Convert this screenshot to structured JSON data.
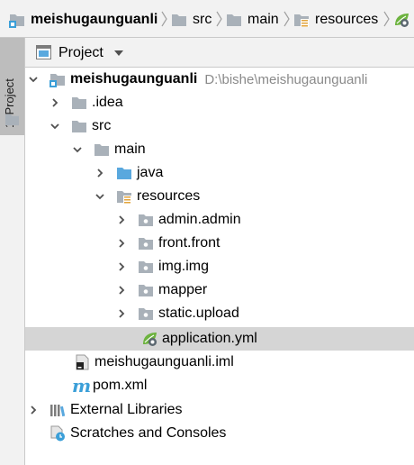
{
  "breadcrumb": {
    "items": [
      {
        "label": "meishugaunguanli",
        "icon": "module-folder-icon"
      },
      {
        "label": "src",
        "icon": "folder-icon"
      },
      {
        "label": "main",
        "icon": "folder-icon"
      },
      {
        "label": "resources",
        "icon": "resources-folder-icon"
      }
    ],
    "trailing_icon": "spring-config-icon"
  },
  "tool_stripe": {
    "tab_label": "1: Project",
    "icon": "folder-icon"
  },
  "panel": {
    "title": "Project",
    "dropdown_icon": "caret-down-icon"
  },
  "tree": [
    {
      "label": "meishugaunguanli",
      "path": "D:\\bishe\\meishugaunguanli",
      "icon": "module-folder-icon",
      "expanded": true
    },
    {
      "label": ".idea",
      "icon": "folder-icon",
      "expanded": false
    },
    {
      "label": "src",
      "icon": "folder-icon",
      "expanded": true
    },
    {
      "label": "main",
      "icon": "folder-icon",
      "expanded": true
    },
    {
      "label": "java",
      "icon": "source-folder-icon",
      "expanded": false
    },
    {
      "label": "resources",
      "icon": "resources-folder-icon",
      "expanded": true
    },
    {
      "label": "admin.admin",
      "icon": "package-icon",
      "expanded": false
    },
    {
      "label": "front.front",
      "icon": "package-icon",
      "expanded": false
    },
    {
      "label": "img.img",
      "icon": "package-icon",
      "expanded": false
    },
    {
      "label": "mapper",
      "icon": "package-icon",
      "expanded": false
    },
    {
      "label": "static.upload",
      "icon": "package-icon",
      "expanded": false
    },
    {
      "label": "application.yml",
      "icon": "spring-config-icon",
      "selected": true
    },
    {
      "label": "meishugaunguanli.iml",
      "icon": "iml-file-icon"
    },
    {
      "label": "pom.xml",
      "icon": "maven-icon"
    },
    {
      "label": "External Libraries",
      "icon": "libraries-icon",
      "expanded": false
    },
    {
      "label": "Scratches and Consoles",
      "icon": "scratches-icon"
    }
  ],
  "colors": {
    "folder": "#a9b1b9",
    "source_folder": "#59a8de",
    "spring": "#6db33f",
    "selection": "#d5d5d5",
    "path_text": "#8a8a8a"
  }
}
